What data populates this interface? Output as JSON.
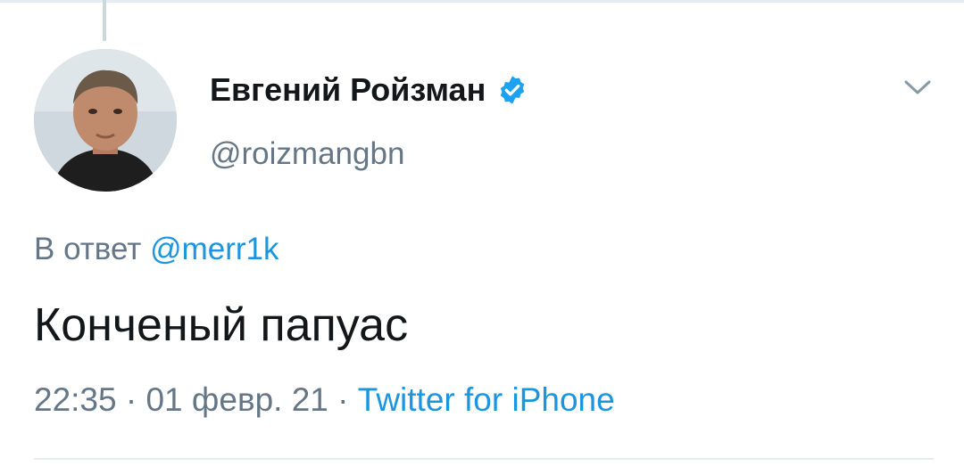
{
  "tweet": {
    "author": {
      "display_name": "Евгений Ройзман",
      "handle": "@roizmangbn",
      "verified": true,
      "avatar_icon": "user-avatar"
    },
    "reply": {
      "prefix": "В ответ",
      "mention": "@merr1k"
    },
    "text": "Конченый папуас",
    "meta": {
      "time": "22:35",
      "separator_1": "·",
      "date": "01 февр. 21",
      "separator_2": "·",
      "source": "Twitter for iPhone"
    },
    "menu_icon": "chevron-down-icon"
  },
  "colors": {
    "primary_text": "#14171a",
    "secondary_text": "#657786",
    "link": "#1b95e0",
    "verified_badge": "#1da1f2",
    "border": "#e6ecf0"
  }
}
